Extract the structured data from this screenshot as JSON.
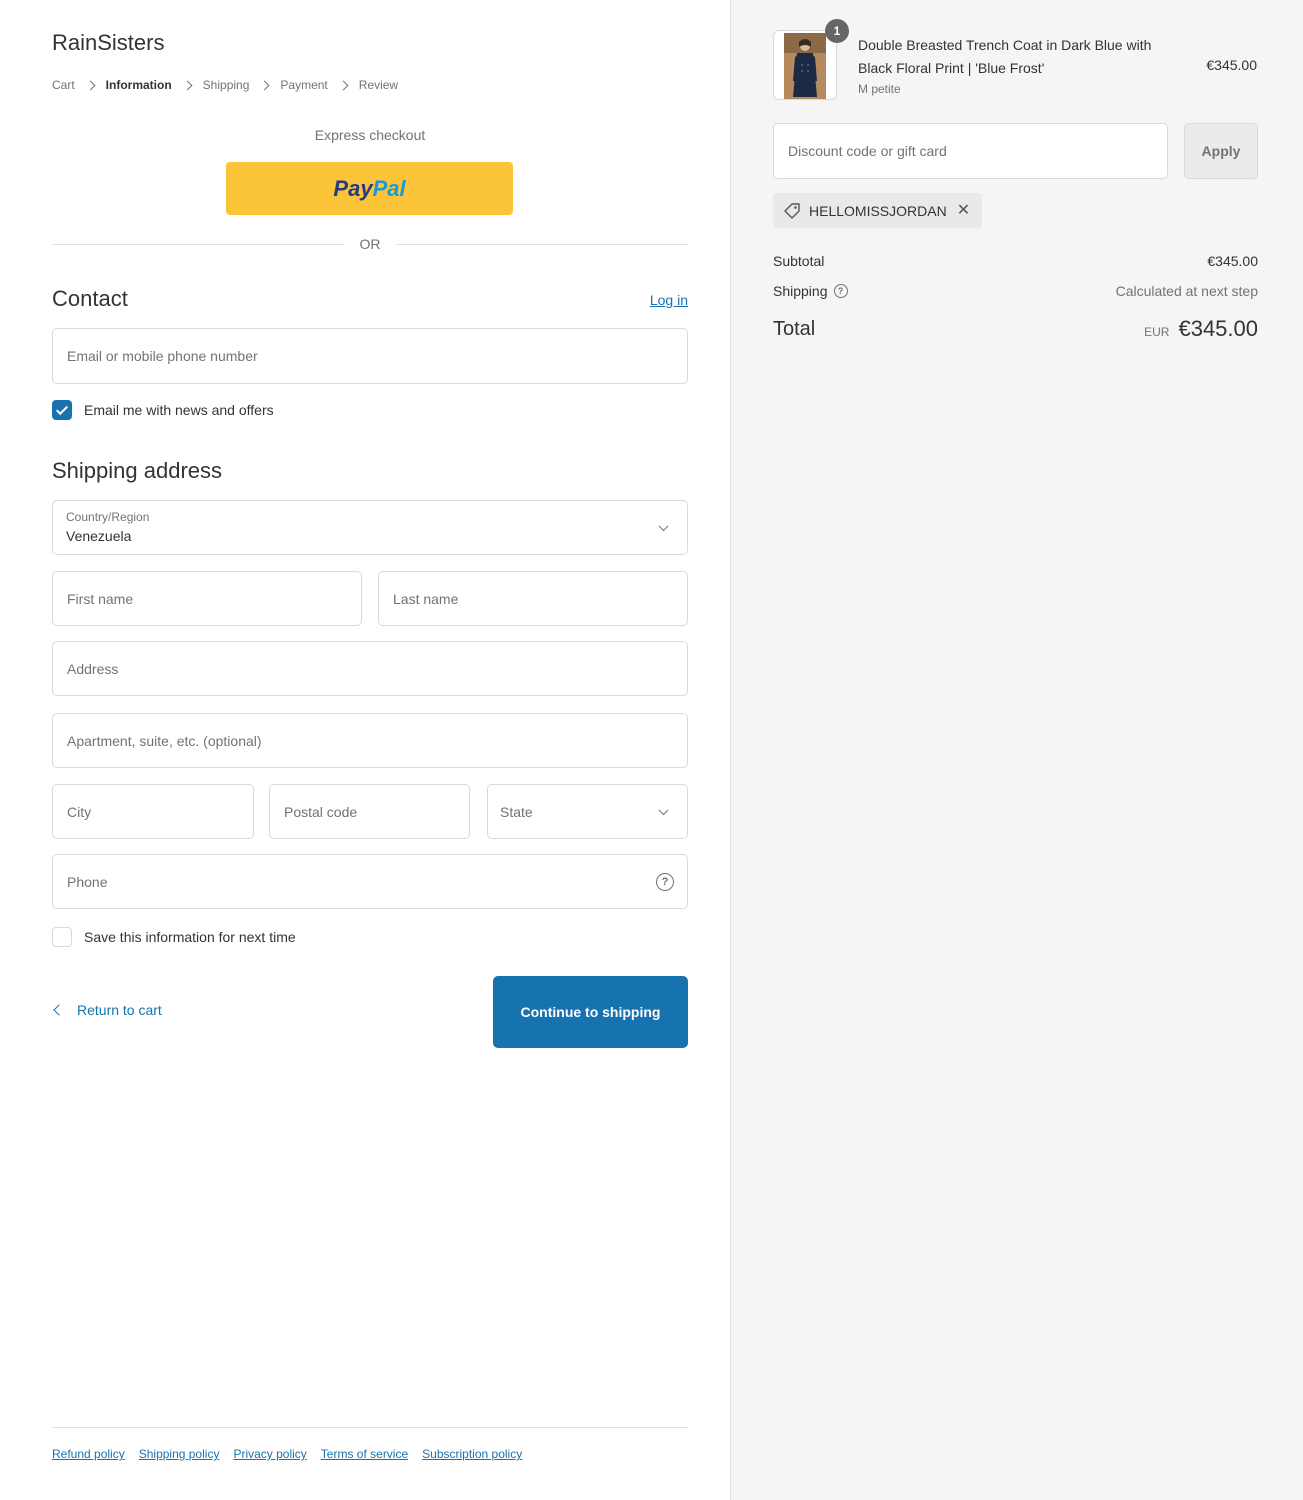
{
  "store": {
    "name": "RainSisters"
  },
  "breadcrumb": [
    {
      "label": "Cart"
    },
    {
      "label": "Information"
    },
    {
      "label": "Shipping"
    },
    {
      "label": "Payment"
    },
    {
      "label": "Review"
    }
  ],
  "express": {
    "label": "Express checkout",
    "paypal_part1": "Pay",
    "paypal_part2": "Pal",
    "or": "OR"
  },
  "contact": {
    "title": "Contact",
    "login_link": "Log in",
    "email_placeholder": "Email or mobile phone number",
    "newsletter_label": "Email me with news and offers",
    "newsletter_checked": true
  },
  "shipping": {
    "title": "Shipping address",
    "country_label": "Country/Region",
    "country_value": "Venezuela",
    "first_name_placeholder": "First name",
    "last_name_placeholder": "Last name",
    "address_placeholder": "Address",
    "apartment_placeholder": "Apartment, suite, etc. (optional)",
    "city_placeholder": "City",
    "postal_placeholder": "Postal code",
    "state_placeholder": "State",
    "phone_placeholder": "Phone",
    "save_label": "Save this information for next time",
    "save_checked": false
  },
  "actions": {
    "return_label": "Return to cart",
    "continue_label": "Continue to shipping"
  },
  "footer": {
    "links": [
      "Refund policy",
      "Shipping policy",
      "Privacy policy",
      "Terms of service",
      "Subscription policy"
    ]
  },
  "summary": {
    "product": {
      "name": "Double Breasted Trench Coat in Dark Blue with Black Floral Print | 'Blue Frost'",
      "variant": "M petite",
      "price": "€345.00",
      "quantity": "1"
    },
    "discount_placeholder": "Discount code or gift card",
    "apply_label": "Apply",
    "applied_code": "HELLOMISSJORDAN",
    "subtotal_label": "Subtotal",
    "subtotal_value": "€345.00",
    "shipping_label": "Shipping",
    "shipping_value": "Calculated at next step",
    "total_label": "Total",
    "total_currency": "EUR",
    "total_value": "€345.00"
  },
  "colors": {
    "accent": "#1773b0",
    "paypal": "#fcc439",
    "summary_bg": "#f5f5f5"
  },
  "icons": [
    "chevron-right-icon",
    "chevron-down-icon",
    "help-icon",
    "check-icon",
    "tag-icon",
    "close-icon",
    "chevron-left-icon"
  ]
}
